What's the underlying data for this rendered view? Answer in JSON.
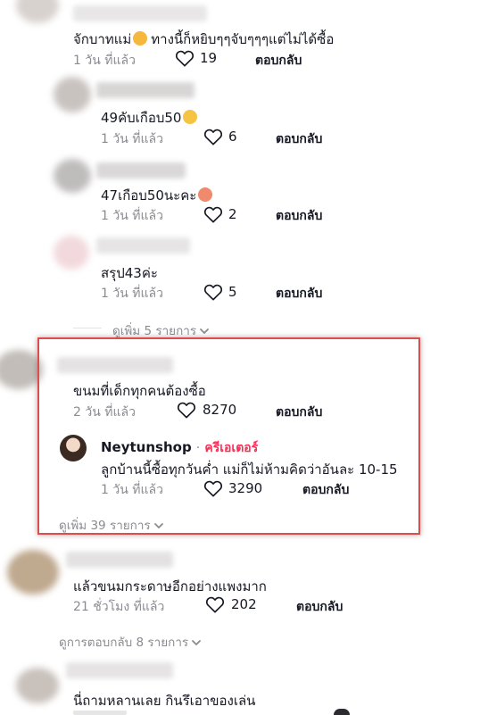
{
  "comments": [
    {
      "text": "จักบาทแม่",
      "text_suffix": "ทางนี้ก็หยิบๆๆจับๆๆๆแต่ไม่ได้ซื้อ",
      "time": "1 วัน ที่แล้ว",
      "likes": "19",
      "reply_label": "ตอบกลับ"
    },
    {
      "text": "49คับเกือบ50",
      "time": "1 วัน ที่แล้ว",
      "likes": "6",
      "reply_label": "ตอบกลับ"
    },
    {
      "text": "47เกือบ50นะคะ",
      "time": "1 วัน ที่แล้ว",
      "likes": "2",
      "reply_label": "ตอบกลับ"
    },
    {
      "text": "สรุป43ค่ะ",
      "time": "1 วัน ที่แล้ว",
      "likes": "5",
      "reply_label": "ตอบกลับ"
    },
    {
      "text": "ขนมที่เด็กทุกคนต้องซื้อ",
      "time": "2 วัน ที่แล้ว",
      "likes": "8270",
      "reply_label": "ตอบกลับ"
    },
    {
      "text": "แล้วขนมกระดาษอีกอย่างแพงมาก",
      "time": "21 ชั่วโมง ที่แล้ว",
      "likes": "202",
      "reply_label": "ตอบกลับ"
    },
    {
      "text": "นี่ถามหลานเลย กินรึเอาของเล่น"
    }
  ],
  "creator_reply": {
    "username": "Neytunshop",
    "separator": "·",
    "badge": "ครีเอเตอร์",
    "text": "ลูกบ้านนี้ซื้อทุกวันค่ำ แม่ก็ไม่ห้ามคิดว่าอันละ 10-15",
    "time": "1 วัน ที่แล้ว",
    "likes": "3290",
    "reply_label": "ตอบกลับ"
  },
  "view_more": {
    "first": "ดูเพิ่ม 5 รายการ",
    "second": "ดูเพิ่ม 39 รายการ",
    "replies": "ดูการตอบกลับ 8 รายการ"
  },
  "colors": {
    "accent_red": "#fe2c55",
    "highlight_border": "#e04b4b",
    "muted": "#8a8b91"
  },
  "icons": {
    "like": "heart-outline-icon",
    "expand": "chevron-down-icon"
  }
}
